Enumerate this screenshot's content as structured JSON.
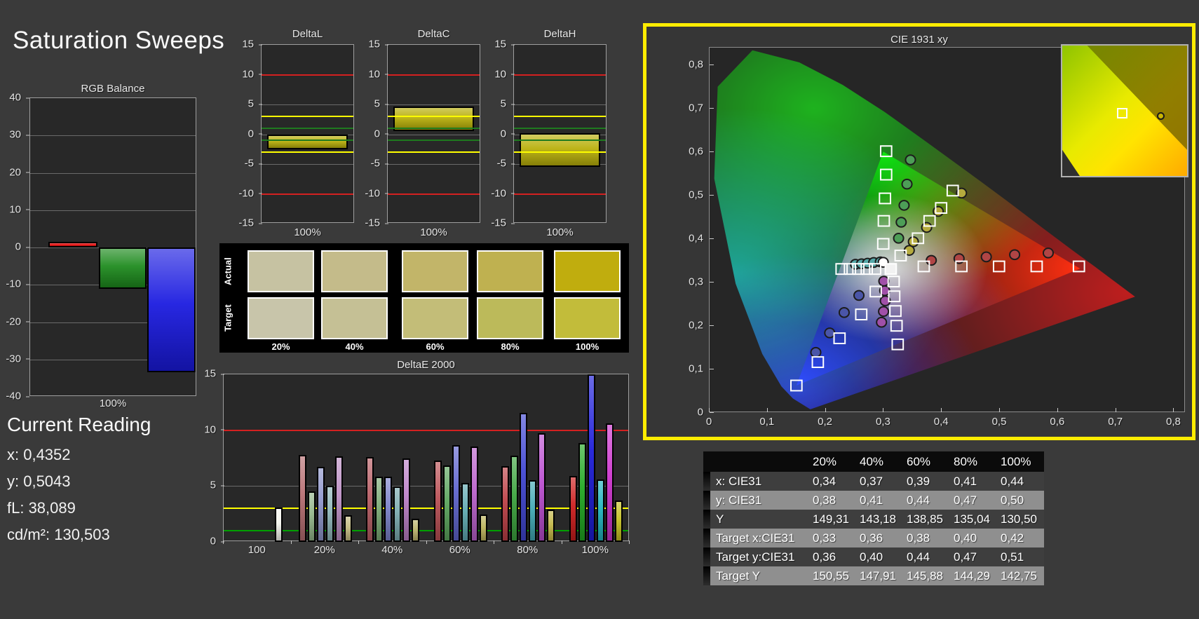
{
  "title": "Saturation Sweeps",
  "current_reading": {
    "heading": "Current Reading",
    "x": "x: 0,4352",
    "y": "y: 0,5043",
    "fl": "fL: 38,089",
    "cdm2": "cd/m²: 130,503"
  },
  "chart_data": {
    "rgb_balance": {
      "type": "bar",
      "title": "RGB Balance",
      "xlabel": "100%",
      "ylim": [
        -40,
        40
      ],
      "yticks": [
        40,
        30,
        20,
        10,
        0,
        -10,
        -20,
        -30,
        -40
      ],
      "categories": [
        "Red",
        "Green",
        "Blue"
      ],
      "values": [
        1.5,
        -11,
        -33.5
      ],
      "colors": [
        "#ee1111",
        "#1e8b1e",
        "#1a1ae0"
      ]
    },
    "delta_charts": {
      "common": {
        "ylim": [
          -15,
          15
        ],
        "yticks": [
          15,
          10,
          5,
          0,
          -5,
          -10,
          -15
        ],
        "xlabel": "100%",
        "ref_lines": [
          {
            "value": 10,
            "color": "#d42020"
          },
          {
            "value": -10,
            "color": "#d42020"
          },
          {
            "value": 3,
            "color": "#ffff00"
          },
          {
            "value": -3,
            "color": "#ffff00"
          },
          {
            "value": 1,
            "color": "#1f7a1f"
          },
          {
            "value": -1,
            "color": "#1f7a1f"
          }
        ]
      },
      "bar_color": "#b9b00b",
      "charts": [
        {
          "title": "DeltaL",
          "type": "bar",
          "bar_from": 0,
          "bar_to": -2.5
        },
        {
          "title": "DeltaC",
          "type": "bar",
          "bar_from": 0.5,
          "bar_to": 4.6
        },
        {
          "title": "DeltaH",
          "type": "bar",
          "bar_from": 0.2,
          "bar_to": -5.5
        }
      ]
    },
    "swatches": {
      "row_labels": [
        "Actual",
        "Target"
      ],
      "col_labels": [
        "20%",
        "40%",
        "60%",
        "80%",
        "100%"
      ],
      "actual": [
        "#c6c2a2",
        "#c4bb8a",
        "#c2b569",
        "#bfb150",
        "#c0ad0e"
      ],
      "target": [
        "#c8c5aa",
        "#c5c095",
        "#c3bd78",
        "#bcba5a",
        "#c2bc3a"
      ]
    },
    "deltae2000": {
      "type": "bar",
      "title": "DeltaE 2000",
      "ylim": [
        0,
        15
      ],
      "yticks": [
        15,
        10,
        5,
        0
      ],
      "ref_lines": [
        {
          "value": 10,
          "color": "#d42020"
        },
        {
          "value": 3,
          "color": "#ffff00"
        },
        {
          "value": 1,
          "color": "#00a000"
        }
      ],
      "groups": [
        {
          "label": "100",
          "values": [
            3.1
          ],
          "colors": [
            "#f5f5ef"
          ]
        },
        {
          "label": "20%",
          "values": [
            7.8,
            4.5,
            6.7,
            5.0,
            7.65,
            2.4
          ],
          "colors": [
            "#b66e72",
            "#93b68a",
            "#8e95cb",
            "#8fb6ba",
            "#bd90c5",
            "#c3bb82"
          ]
        },
        {
          "label": "40%",
          "values": [
            7.6,
            5.85,
            5.85,
            4.95,
            7.5,
            2.1
          ],
          "colors": [
            "#b95f66",
            "#7cab75",
            "#7b82c9",
            "#7cabb1",
            "#bb7fc7",
            "#bcb46d"
          ]
        },
        {
          "label": "60%",
          "values": [
            7.25,
            6.85,
            8.65,
            5.25,
            8.55,
            2.45
          ],
          "colors": [
            "#bb5156",
            "#5da65e",
            "#6065ce",
            "#60aab2",
            "#bb62cc",
            "#bcb45c"
          ]
        },
        {
          "label": "80%",
          "values": [
            6.75,
            7.7,
            11.55,
            5.5,
            9.7,
            2.9
          ],
          "colors": [
            "#bd4147",
            "#3da53f",
            "#4147d3",
            "#41a9b4",
            "#bb4ed0",
            "#c3b748"
          ]
        },
        {
          "label": "100%",
          "values": [
            5.9,
            8.85,
            15,
            5.6,
            10.6,
            3.7
          ],
          "colors": [
            "#cc1d1d",
            "#21a821",
            "#1d1dd8",
            "#21b4bd",
            "#cc33cc",
            "#c5c122"
          ]
        }
      ]
    },
    "cie": {
      "type": "scatter",
      "title": "CIE 1931 xy",
      "xticks": [
        "0",
        "0,1",
        "0,2",
        "0,3",
        "0,4",
        "0,5",
        "0,6",
        "0,7",
        "0,8"
      ],
      "yticks": [
        "0",
        "0,1",
        "0,2",
        "0,3",
        "0,4",
        "0,5",
        "0,6",
        "0,7",
        "0,8"
      ],
      "xtick_values": [
        0,
        0.1,
        0.2,
        0.3,
        0.4,
        0.5,
        0.6,
        0.7,
        0.8
      ],
      "ytick_values": [
        0,
        0.1,
        0.2,
        0.3,
        0.4,
        0.5,
        0.6,
        0.7,
        0.8
      ],
      "targets": {
        "red": [
          [
            0.37,
            0.335
          ],
          [
            0.435,
            0.335
          ],
          [
            0.5,
            0.335
          ],
          [
            0.565,
            0.335
          ],
          [
            0.638,
            0.335
          ]
        ],
        "green": [
          [
            0.305,
            0.601
          ],
          [
            0.305,
            0.547
          ],
          [
            0.303,
            0.492
          ],
          [
            0.301,
            0.44
          ],
          [
            0.3,
            0.387
          ]
        ],
        "yellow": [
          [
            0.33,
            0.36
          ],
          [
            0.36,
            0.4
          ],
          [
            0.38,
            0.44
          ],
          [
            0.4,
            0.47
          ],
          [
            0.42,
            0.51
          ]
        ],
        "cyan": [
          [
            0.228,
            0.329
          ],
          [
            0.2425,
            0.329
          ],
          [
            0.257,
            0.329
          ],
          [
            0.2715,
            0.329
          ],
          [
            0.286,
            0.329
          ]
        ],
        "magenta": [
          [
            0.318,
            0.3
          ],
          [
            0.319,
            0.266
          ],
          [
            0.321,
            0.232
          ],
          [
            0.323,
            0.198
          ],
          [
            0.325,
            0.155
          ]
        ],
        "blue": [
          [
            0.287,
            0.277
          ],
          [
            0.262,
            0.224
          ],
          [
            0.2245,
            0.169
          ],
          [
            0.187,
            0.114
          ],
          [
            0.15,
            0.06
          ]
        ],
        "white": [
          [
            0.313,
            0.329
          ]
        ]
      },
      "measured": [
        {
          "name": "red",
          "color": "#b04545",
          "points": [
            [
              0.383,
              0.349
            ],
            [
              0.431,
              0.353
            ],
            [
              0.478,
              0.357
            ],
            [
              0.527,
              0.362
            ],
            [
              0.585,
              0.366
            ]
          ]
        },
        {
          "name": "green",
          "color": "#4d9e57",
          "points": [
            [
              0.347,
              0.581
            ],
            [
              0.341,
              0.525
            ],
            [
              0.336,
              0.476
            ],
            [
              0.331,
              0.437
            ],
            [
              0.3265,
              0.4
            ]
          ]
        },
        {
          "name": "yellow",
          "color": "#b5ab3e",
          "points": [
            [
              0.345,
              0.372
            ],
            [
              0.352,
              0.392
            ],
            [
              0.375,
              0.425
            ],
            [
              0.395,
              0.462
            ],
            [
              0.4352,
              0.5043
            ]
          ]
        },
        {
          "name": "cyan",
          "color": "#55a8a8",
          "points": [
            [
              0.252,
              0.34
            ],
            [
              0.2625,
              0.341
            ],
            [
              0.273,
              0.3425
            ],
            [
              0.2835,
              0.344
            ],
            [
              0.295,
              0.3455
            ]
          ]
        },
        {
          "name": "magenta",
          "color": "#a050a8",
          "points": [
            [
              0.301,
              0.301
            ],
            [
              0.3025,
              0.279
            ],
            [
              0.3035,
              0.2555
            ],
            [
              0.3005,
              0.231
            ],
            [
              0.297,
              0.206
            ]
          ]
        },
        {
          "name": "blue",
          "color": "#4a55a8",
          "points": [
            [
              0.258,
              0.268
            ],
            [
              0.2325,
              0.2285
            ],
            [
              0.2075,
              0.1815
            ],
            [
              0.1835,
              0.1365
            ]
          ]
        },
        {
          "name": "white",
          "color": "#ffffff",
          "points": [
            [
              0.3,
              0.3445
            ]
          ]
        }
      ]
    },
    "table": {
      "type": "table",
      "col_headers": [
        "20%",
        "40%",
        "60%",
        "80%",
        "100%"
      ],
      "rows": [
        {
          "label": "x: CIE31",
          "values": [
            "0,34",
            "0,37",
            "0,39",
            "0,41",
            "0,44"
          ]
        },
        {
          "label": "y: CIE31",
          "values": [
            "0,38",
            "0,41",
            "0,44",
            "0,47",
            "0,50"
          ]
        },
        {
          "label": "Y",
          "values": [
            "149,31",
            "143,18",
            "138,85",
            "135,04",
            "130,50"
          ]
        },
        {
          "label": "Target x:CIE31",
          "values": [
            "0,33",
            "0,36",
            "0,38",
            "0,40",
            "0,42"
          ]
        },
        {
          "label": "Target y:CIE31",
          "values": [
            "0,36",
            "0,40",
            "0,44",
            "0,47",
            "0,51"
          ]
        },
        {
          "label": "Target Y",
          "values": [
            "150,55",
            "147,91",
            "145,88",
            "144,29",
            "142,75"
          ]
        }
      ]
    }
  }
}
